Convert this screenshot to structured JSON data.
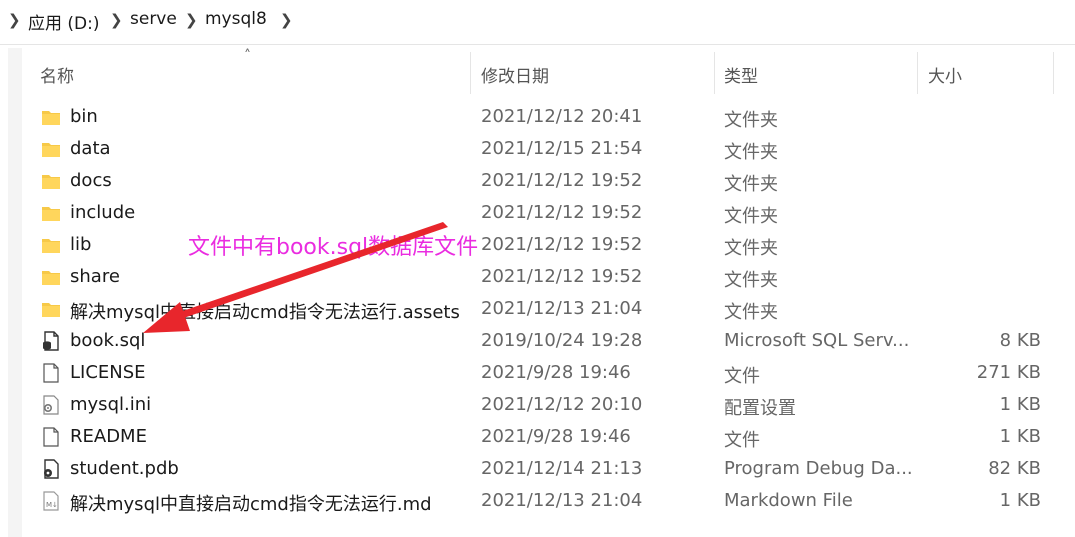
{
  "breadcrumb": {
    "items": [
      "应用 (D:)",
      "serve",
      "mysql8"
    ]
  },
  "columns": {
    "name": "名称",
    "modified": "修改日期",
    "type": "类型",
    "size": "大小"
  },
  "files": [
    {
      "name": "bin",
      "date": "2021/12/12 20:41",
      "type": "文件夹",
      "size": "",
      "icon": "folder-icon"
    },
    {
      "name": "data",
      "date": "2021/12/15 21:54",
      "type": "文件夹",
      "size": "",
      "icon": "folder-icon"
    },
    {
      "name": "docs",
      "date": "2021/12/12 19:52",
      "type": "文件夹",
      "size": "",
      "icon": "folder-icon"
    },
    {
      "name": "include",
      "date": "2021/12/12 19:52",
      "type": "文件夹",
      "size": "",
      "icon": "folder-icon"
    },
    {
      "name": "lib",
      "date": "2021/12/12 19:52",
      "type": "文件夹",
      "size": "",
      "icon": "folder-icon"
    },
    {
      "name": "share",
      "date": "2021/12/12 19:52",
      "type": "文件夹",
      "size": "",
      "icon": "folder-icon"
    },
    {
      "name": "解决mysql中直接启动cmd指令无法运行.assets",
      "date": "2021/12/13 21:04",
      "type": "文件夹",
      "size": "",
      "icon": "folder-icon"
    },
    {
      "name": "book.sql",
      "date": "2019/10/24 19:28",
      "type": "Microsoft SQL Serv...",
      "size": "8 KB",
      "icon": "sql-file-icon"
    },
    {
      "name": "LICENSE",
      "date": "2021/9/28 19:46",
      "type": "文件",
      "size": "271 KB",
      "icon": "blank-file-icon"
    },
    {
      "name": "mysql.ini",
      "date": "2021/12/12 20:10",
      "type": "配置设置",
      "size": "1 KB",
      "icon": "settings-file-icon"
    },
    {
      "name": "README",
      "date": "2021/9/28 19:46",
      "type": "文件",
      "size": "1 KB",
      "icon": "blank-file-icon"
    },
    {
      "name": "student.pdb",
      "date": "2021/12/14 21:13",
      "type": "Program Debug Da...",
      "size": "82 KB",
      "icon": "pdb-file-icon"
    },
    {
      "name": "解决mysql中直接启动cmd指令无法运行.md",
      "date": "2021/12/13 21:04",
      "type": "Markdown File",
      "size": "1 KB",
      "icon": "markdown-file-icon"
    }
  ],
  "annotation": {
    "text": "文件中有book.sql数据库文件",
    "color": "#ea2ce0",
    "arrow_color": "#e8262c"
  }
}
